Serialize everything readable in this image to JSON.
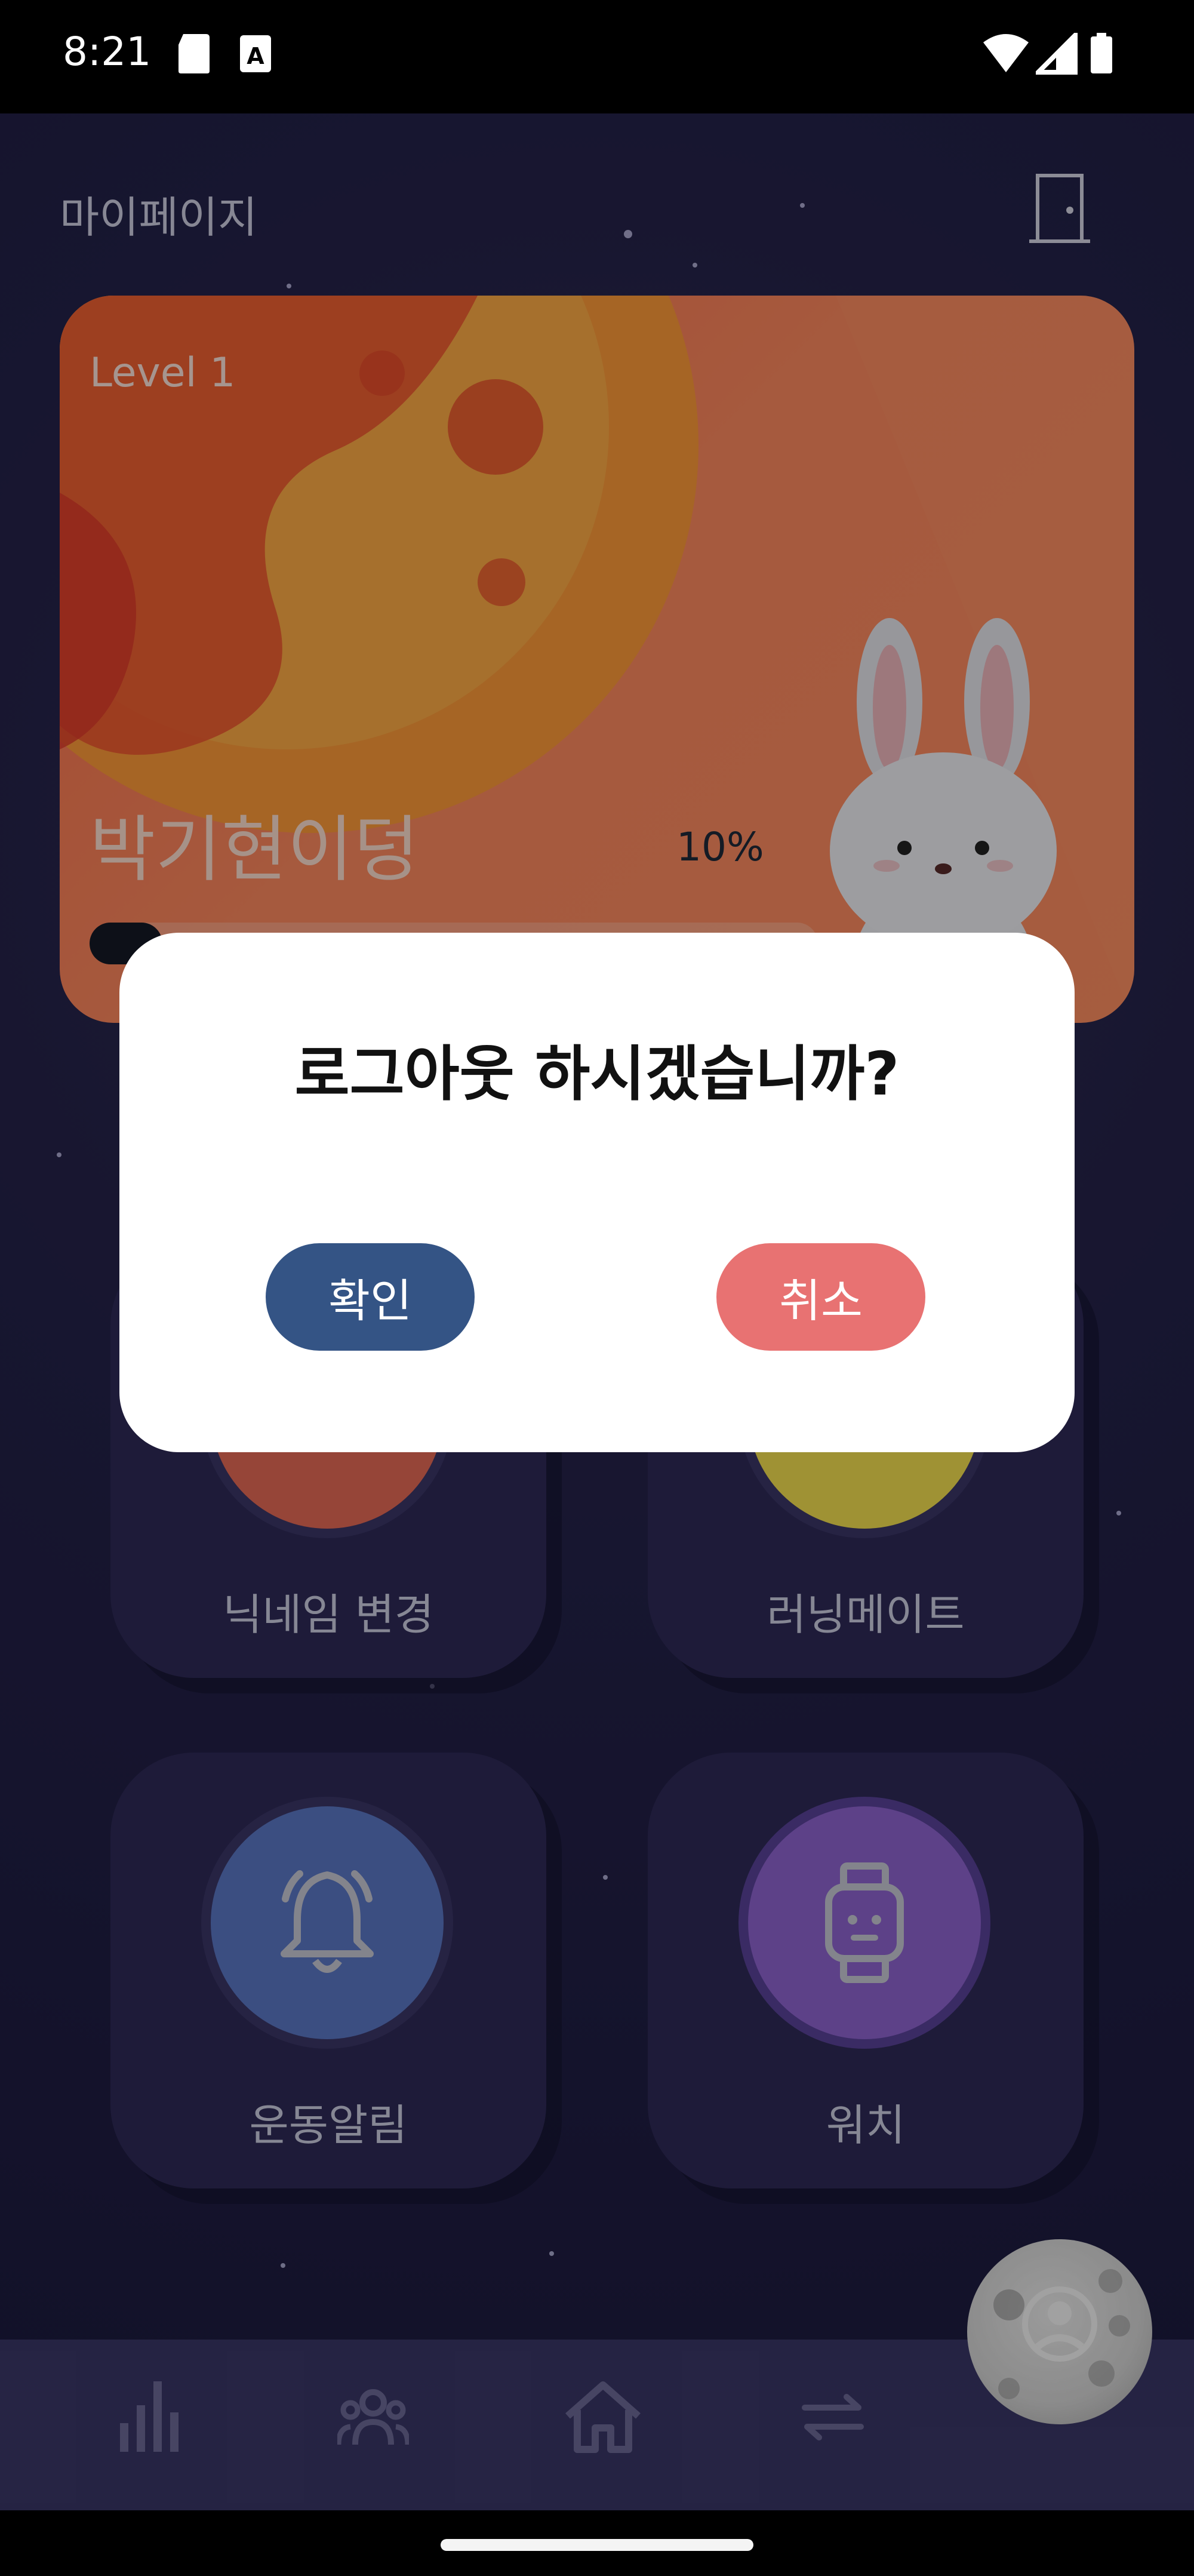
{
  "status_bar": {
    "time": "8:21",
    "left_icons": [
      "sd-card-icon",
      "keyboard-a-icon"
    ],
    "right_icons": [
      "wifi-icon",
      "signal-icon",
      "battery-icon"
    ]
  },
  "header": {
    "title": "마이페이지",
    "logout_icon": "door-icon"
  },
  "level_card": {
    "level": "Level 1",
    "nickname": "박기현이덩",
    "progress_label": "10%",
    "progress_value": 0.1,
    "character": "rabbit"
  },
  "menu": {
    "items": [
      {
        "label": "닉네임 변경",
        "icon": "nickname-icon",
        "color": "#e66a57"
      },
      {
        "label": "러닝메이트",
        "icon": "running-mate-icon",
        "color": "#f5e150"
      },
      {
        "label": "운동알림",
        "icon": "bell-icon",
        "color": "#5b78c7"
      },
      {
        "label": "워치",
        "icon": "watch-icon",
        "color": "#8f64d2"
      }
    ]
  },
  "bottom_nav": {
    "items": [
      {
        "icon": "chart-bars-icon"
      },
      {
        "icon": "group-icon"
      },
      {
        "icon": "home-icon"
      },
      {
        "icon": "swap-arrows-icon"
      }
    ],
    "fab_icon": "profile-moon-icon"
  },
  "dialog": {
    "title": "로그아웃 하시겠습니까?",
    "confirm_label": "확인",
    "cancel_label": "취소"
  },
  "colors": {
    "background": "#24224a",
    "card": "#ff7b52",
    "confirm": "#345485",
    "cancel": "#e87272",
    "nav": "#3a3768"
  }
}
